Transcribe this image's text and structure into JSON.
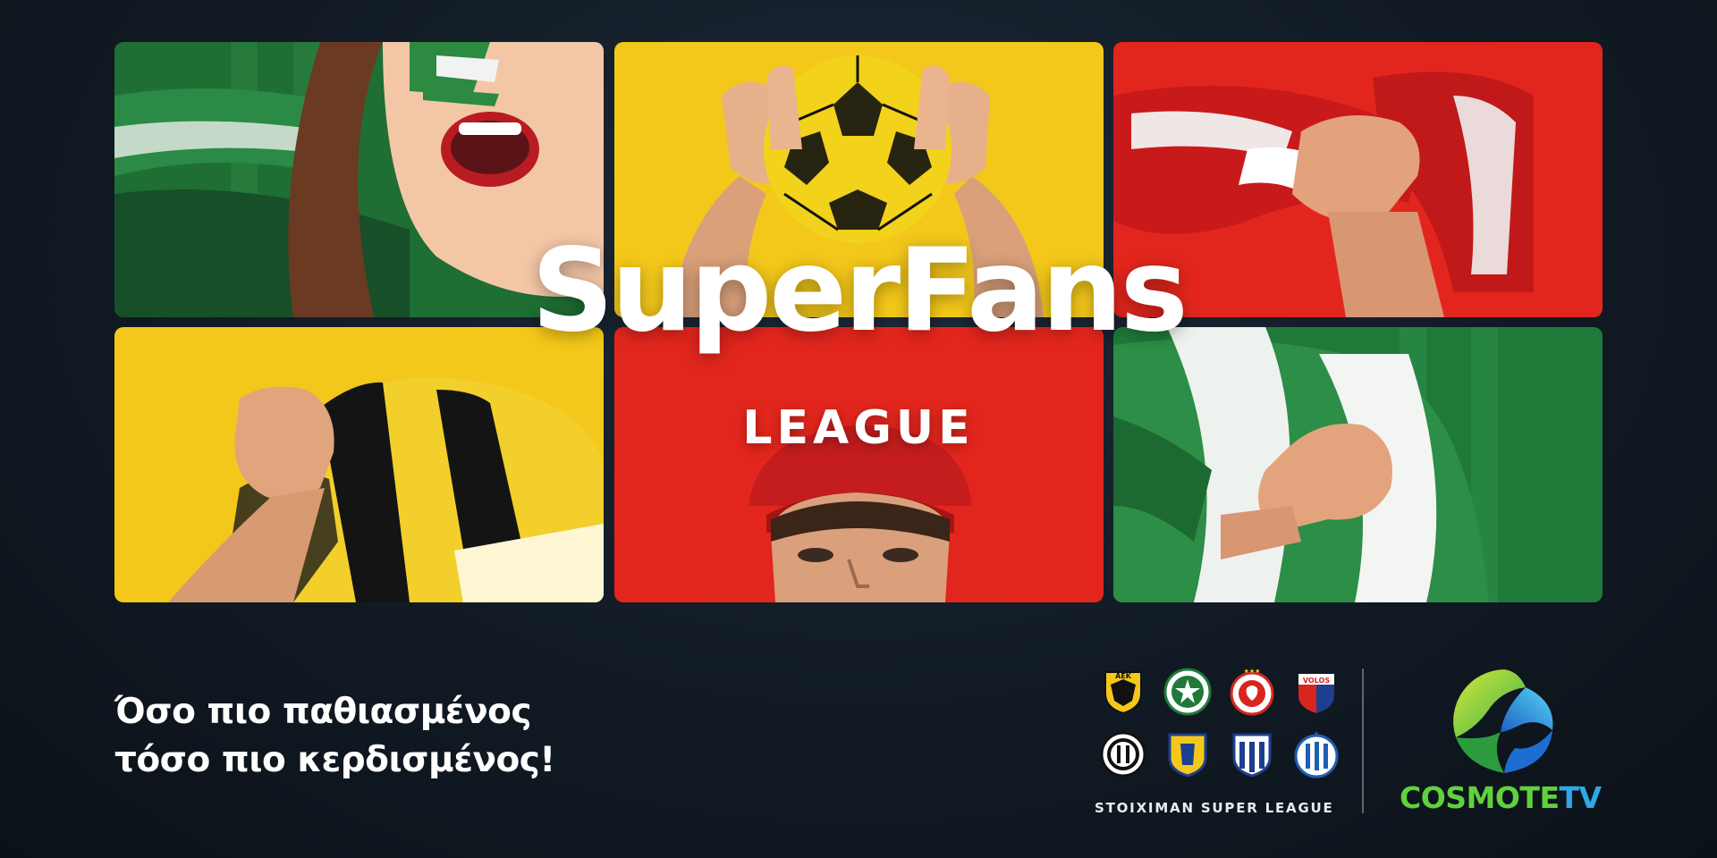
{
  "title": "SuperFans",
  "subtitle": "LEAGUE",
  "slogan": {
    "line1": "Όσο πιο παθιασμένος",
    "line2": "τόσο πιο κερδισμένος!"
  },
  "league": {
    "label": "STOIXIMAN SUPER LEAGUE",
    "badges": [
      {
        "name": "aek",
        "text": "ΑΕΚ"
      },
      {
        "name": "panathinaikos"
      },
      {
        "name": "olympiacos"
      },
      {
        "name": "volos",
        "text": "VOLOS"
      },
      {
        "name": "ofi"
      },
      {
        "name": "panetolikos"
      },
      {
        "name": "lamia"
      },
      {
        "name": "atromitos"
      }
    ]
  },
  "brand": {
    "part1": "COSMOTE",
    "part2": "TV",
    "green": "#5fd23c",
    "blue": "#2ea8e6"
  },
  "colors": {
    "green_tile": "#1f6e34",
    "yellow_tile": "#f2c418",
    "red_tile": "#e3261d",
    "background": "#141d28"
  }
}
